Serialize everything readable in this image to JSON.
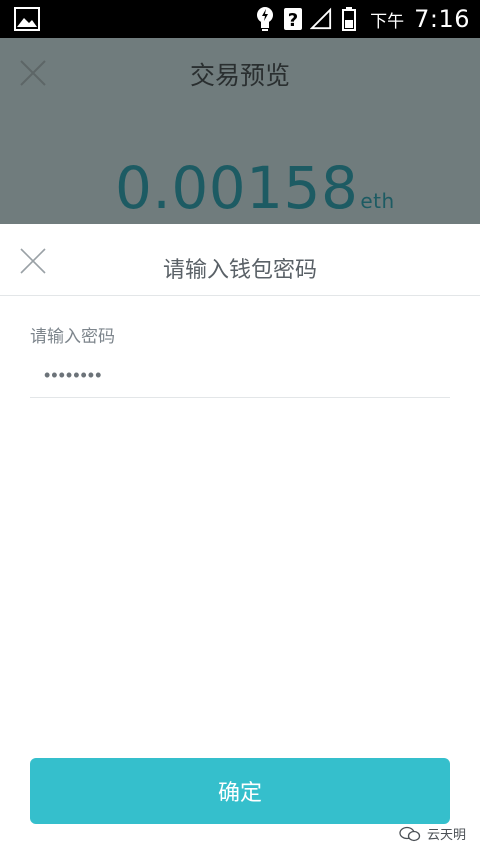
{
  "status_bar": {
    "ampm": "下午",
    "time": "7:16",
    "icons": [
      "gallery-icon",
      "lightbulb-icon",
      "question-icon",
      "signal-icon",
      "battery-icon"
    ]
  },
  "background_page": {
    "title": "交易预览",
    "amount": "0.00158",
    "unit": "eth"
  },
  "sheet": {
    "title": "请输入钱包密码",
    "password_label": "请输入密码",
    "password_value": "••••••••",
    "confirm_label": "确定"
  },
  "watermark": {
    "text": "云天明"
  },
  "colors": {
    "accent": "#35bfcc",
    "dim_overlay": "#707c7d",
    "amount_text": "#1d5b63"
  }
}
